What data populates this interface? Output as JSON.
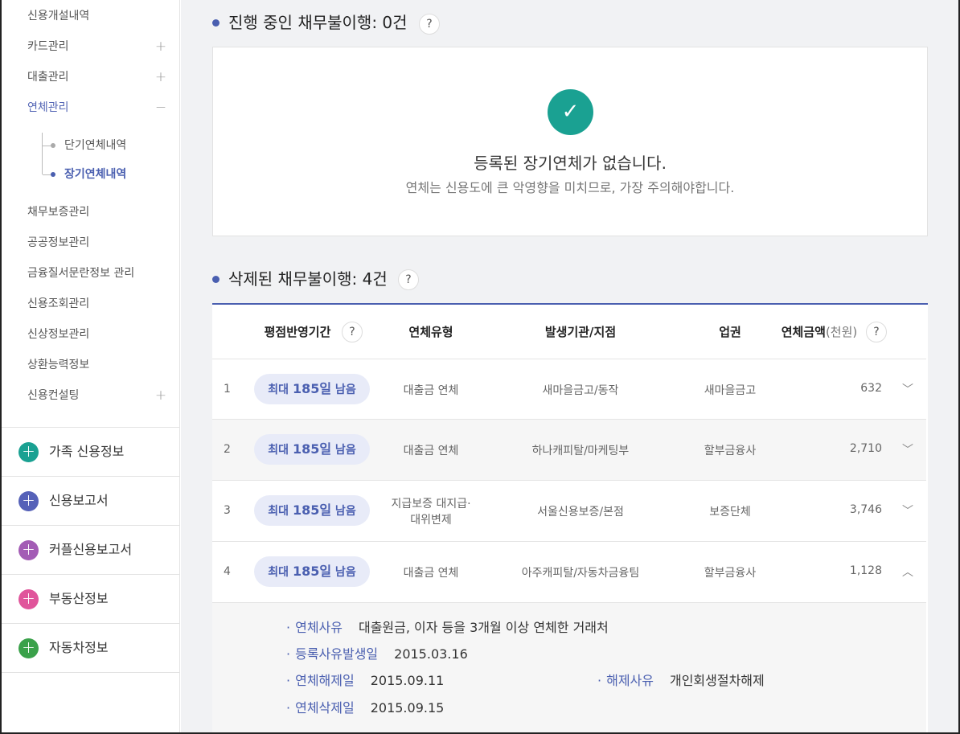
{
  "sidebar": {
    "menu": [
      {
        "label": "신용개설내역",
        "toggle": ""
      },
      {
        "label": "카드관리",
        "toggle": "+"
      },
      {
        "label": "대출관리",
        "toggle": "+"
      },
      {
        "label": "연체관리",
        "toggle": "−"
      },
      {
        "label": "채무보증관리",
        "toggle": ""
      },
      {
        "label": "공공정보관리",
        "toggle": ""
      },
      {
        "label": "금융질서문란정보 관리",
        "toggle": ""
      },
      {
        "label": "신용조회관리",
        "toggle": ""
      },
      {
        "label": "신상정보관리",
        "toggle": ""
      },
      {
        "label": "상환능력정보",
        "toggle": ""
      },
      {
        "label": "신용컨설팅",
        "toggle": "+"
      }
    ],
    "sub_items": [
      "단기연체내역",
      "장기연체내역"
    ],
    "quick": [
      {
        "label": "가족 신용정보",
        "color": "#1aa192"
      },
      {
        "label": "신용보고서",
        "color": "#5561b8"
      },
      {
        "label": "커플신용보고서",
        "color": "#a35cb5"
      },
      {
        "label": "부동산정보",
        "color": "#e0559b"
      },
      {
        "label": "자동차정보",
        "color": "#3aa14a"
      }
    ]
  },
  "ongoing": {
    "title": "진행 중인 채무불이행: 0건",
    "help": "?",
    "empty_title": "등록된 장기연체가 없습니다.",
    "empty_sub": "연체는 신용도에 큰 악영향을 미치므로, 가장 주의해야합니다."
  },
  "deleted": {
    "title": "삭제된 채무불이행: 4건",
    "help": "?",
    "headers": {
      "period": "평점반영기간",
      "type": "연체유형",
      "org": "발생기관/지점",
      "sector": "업권",
      "amount": "연체금액",
      "unit": "(천원)"
    },
    "rows": [
      {
        "no": "1",
        "pill_prefix": "최대 ",
        "pill_days": "185일",
        "pill_suffix": " 남음",
        "type": "대출금 연체",
        "type2": "",
        "org": "새마을금고/동작",
        "sector": "새마을금고",
        "amount": "632",
        "chev": "﹀"
      },
      {
        "no": "2",
        "pill_prefix": "최대 ",
        "pill_days": "185일",
        "pill_suffix": " 남음",
        "type": "대출금 연체",
        "type2": "",
        "org": "하나캐피탈/마케팅부",
        "sector": "할부금융사",
        "amount": "2,710",
        "chev": "﹀"
      },
      {
        "no": "3",
        "pill_prefix": "최대 ",
        "pill_days": "185일",
        "pill_suffix": " 남음",
        "type": "지급보증 대지급·",
        "type2": "대위변제",
        "org": "서울신용보증/본점",
        "sector": "보증단체",
        "amount": "3,746",
        "chev": "﹀"
      },
      {
        "no": "4",
        "pill_prefix": "최대 ",
        "pill_days": "185일",
        "pill_suffix": " 남음",
        "type": "대출금 연체",
        "type2": "",
        "org": "아주캐피탈/자동차금융팀",
        "sector": "할부금융사",
        "amount": "1,128",
        "chev": "︿"
      }
    ],
    "detail": {
      "reason_label": "연체사유",
      "reason_val": "대출원금, 이자 등을 3개월 이상 연체한 거래처",
      "regdate_label": "등록사유발생일",
      "regdate_val": "2015.03.16",
      "release_label": "연체해제일",
      "release_val": "2015.09.11",
      "release_reason_label": "해제사유",
      "release_reason_val": "개인회생절차해제",
      "delete_label": "연체삭제일",
      "delete_val": "2015.09.15"
    }
  }
}
